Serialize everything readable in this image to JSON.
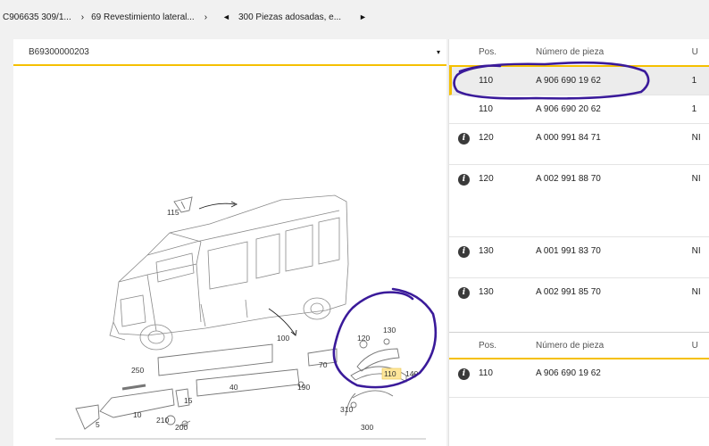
{
  "breadcrumb": {
    "items": [
      "C906635 309/1...",
      "69 Revestimiento lateral...",
      "300 Piezas adosadas, e..."
    ],
    "sep_next": "›",
    "sep_back": "◄",
    "sep_forward": "►"
  },
  "selector": {
    "value": "B69300000203",
    "caret": "▾"
  },
  "diagram": {
    "labels": [
      "115",
      "100",
      "250",
      "40",
      "70",
      "190",
      "10",
      "15",
      "210",
      "200",
      "5",
      "120",
      "130",
      "110",
      "140",
      "310",
      "300"
    ]
  },
  "table": {
    "headers": {
      "pos": "Pos.",
      "number": "Número de pieza",
      "qty": "U"
    },
    "rows": [
      {
        "info": false,
        "pos": "110",
        "number": "A 906 690 19 62",
        "qty": "1",
        "selected": true
      },
      {
        "info": false,
        "pos": "110",
        "number": "A 906 690 20 62",
        "qty": "1",
        "selected": false
      },
      {
        "info": true,
        "pos": "120",
        "number": "A 000 991 84 71",
        "qty": "NI",
        "selected": false
      },
      {
        "info": true,
        "pos": "120",
        "number": "A 002 991 88 70",
        "qty": "NI",
        "selected": false
      },
      {
        "info": true,
        "pos": "130",
        "number": "A 001 991 83 70",
        "qty": "NI",
        "selected": false
      },
      {
        "info": true,
        "pos": "130",
        "number": "A 002 991 85 70",
        "qty": "NI",
        "selected": false
      }
    ],
    "second_headers": {
      "pos": "Pos.",
      "number": "Número de pieza",
      "qty": "U"
    },
    "second_rows": [
      {
        "info": true,
        "pos": "110",
        "number": "A 906 690 19 62",
        "qty": ""
      }
    ],
    "info_glyph": "i"
  },
  "colors": {
    "accent": "#f5c000",
    "annotation": "#3a1a9a"
  }
}
